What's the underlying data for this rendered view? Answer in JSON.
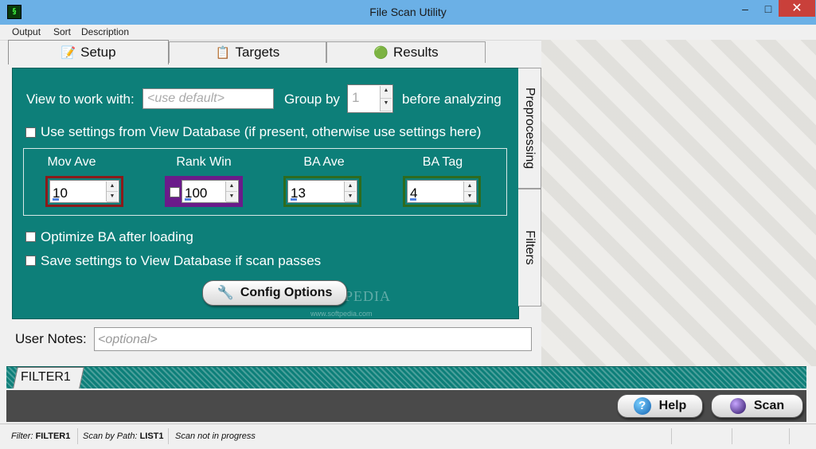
{
  "window": {
    "title": "File Scan Utility",
    "minimize": "–",
    "maximize": "□",
    "close": "✕"
  },
  "menu": [
    "Output",
    "Sort",
    "Description"
  ],
  "tabs": [
    {
      "label": "Setup",
      "icon": "setup-icon"
    },
    {
      "label": "Targets",
      "icon": "targets-icon"
    },
    {
      "label": "Results",
      "icon": "results-icon"
    }
  ],
  "setup": {
    "view_label": "View to work with:",
    "view_placeholder": "<use default>",
    "group_by_label": "Group by",
    "group_by_value": "1",
    "before_label": "before analyzing",
    "use_db_label": "Use settings from View Database (if present, otherwise use settings here)",
    "params": [
      {
        "label": "Mov Ave",
        "value": "10",
        "color": "#8b1a1a"
      },
      {
        "label": "Rank Win",
        "value": "100",
        "color": "#6a1b8a"
      },
      {
        "label": "BA Ave",
        "value": "13",
        "color": "#2e6b1f"
      },
      {
        "label": "BA Tag",
        "value": "4",
        "color": "#2e6b1f"
      }
    ],
    "optimize_label": "Optimize BA after loading",
    "save_label": "Save settings to View Database if scan passes",
    "config_button": "Config Options"
  },
  "side_tabs": [
    "Preprocessing",
    "Filters"
  ],
  "notes": {
    "label": "User Notes:",
    "placeholder": "<optional>"
  },
  "filter_tab": "FILTER1",
  "buttons": {
    "help": "Help",
    "help_icon": "?",
    "scan": "Scan"
  },
  "status": {
    "filter_key": "Filter:",
    "filter_val": "FILTER1",
    "path_key": "Scan by Path:",
    "path_val": "LIST1",
    "progress": "Scan not in progress"
  },
  "watermark": {
    "brand": "SOFTPEDIA",
    "url": "www.softpedia.com"
  }
}
